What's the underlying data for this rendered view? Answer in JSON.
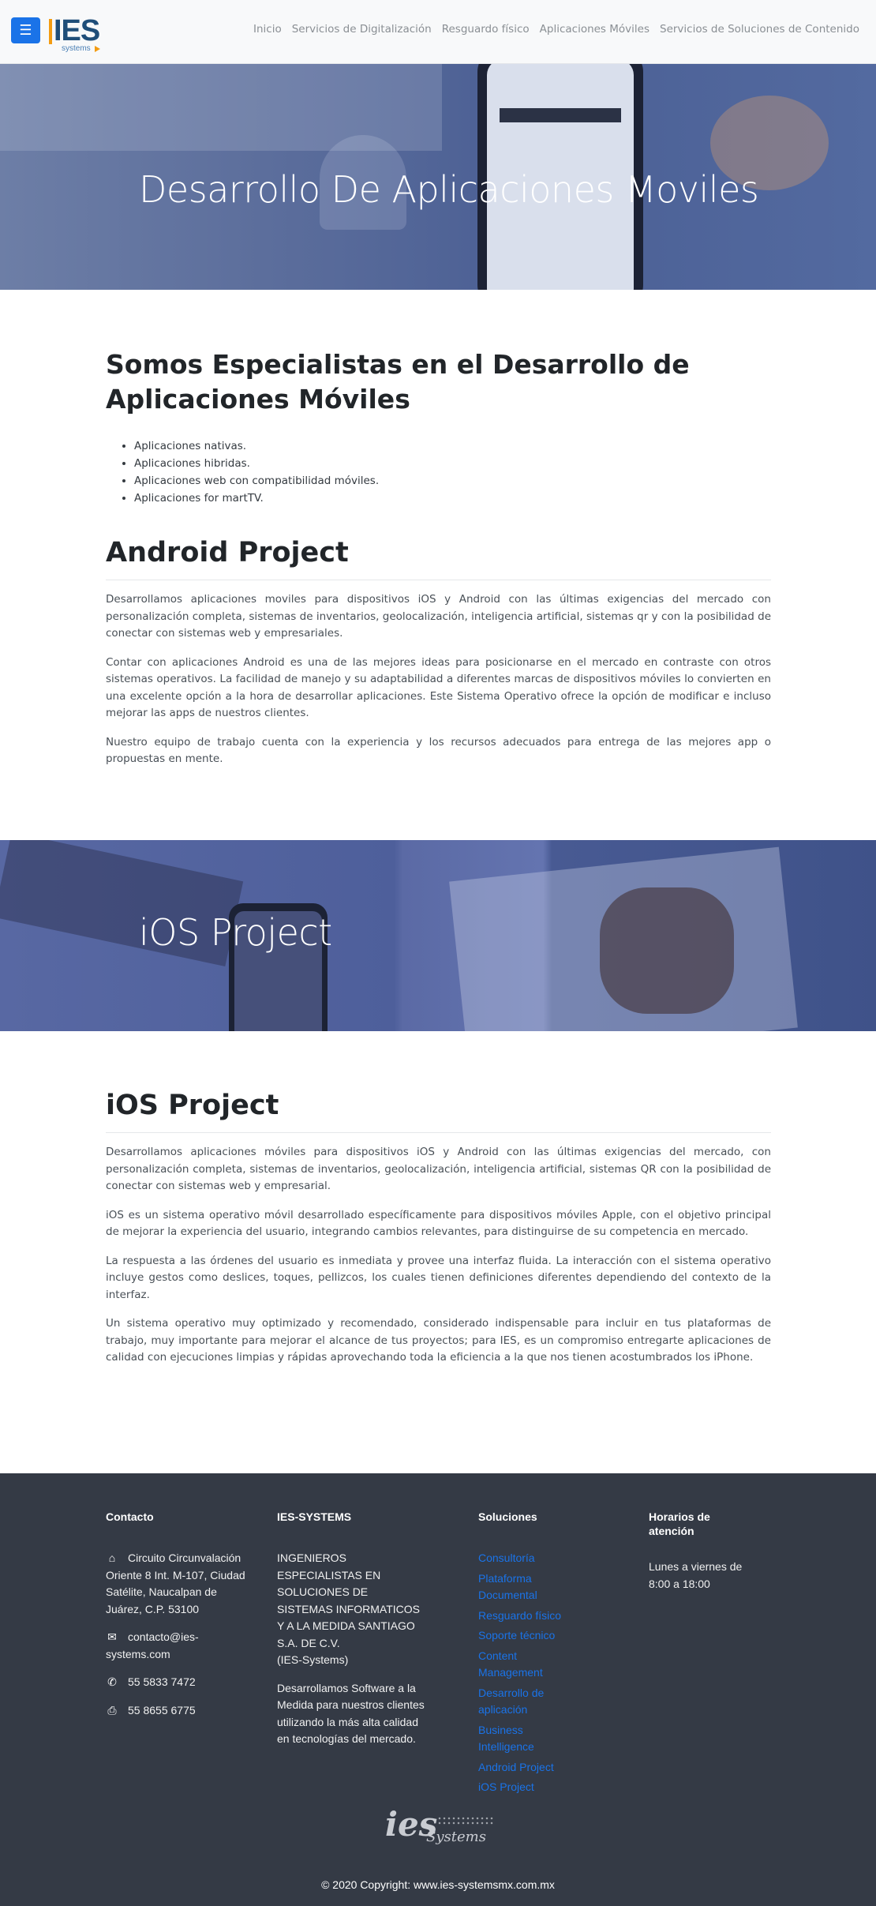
{
  "navbar": {
    "toggle_icon": "☰",
    "logo": {
      "text": "IES",
      "sub": "systems"
    },
    "links": [
      "Inicio",
      "Servicios de Digitalización",
      "Resguardo físico",
      "Aplicaciones Móviles",
      "Servicios de Soluciones de Contenido"
    ]
  },
  "hero": {
    "title": "Desarrollo De Aplicaciones Moviles"
  },
  "intro": {
    "heading": "Somos Especialistas en el Desarrollo de Aplicaciones Móviles",
    "features": [
      "Aplicaciones nativas.",
      "Aplicaciones hibridas.",
      "Aplicaciones web con compatibilidad móviles.",
      "Aplicaciones for martTV."
    ]
  },
  "android": {
    "heading": "Android Project",
    "paragraphs": [
      "Desarrollamos aplicaciones moviles para dispositivos iOS y Android con las últimas exigencias del mercado con personalización completa, sistemas de inventarios, geolocalización, inteligencia artificial, sistemas qr y con la posibilidad de conectar con sistemas web y empresariales.",
      "Contar con aplicaciones Android es una de las mejores ideas para posicionarse en el mercado en contraste con otros sistemas operativos. La facilidad de manejo y su adaptabilidad a diferentes marcas de dispositivos móviles lo convierten en una excelente opción a la hora de desarrollar aplicaciones. Este Sistema Operativo ofrece la opción de modificar e incluso mejorar las apps de nuestros clientes.",
      "Nuestro equipo de trabajo cuenta con la experiencia y los recursos adecuados para entrega de las mejores app o propuestas en mente."
    ]
  },
  "ios_banner": {
    "title": "iOS Project"
  },
  "ios": {
    "heading": "iOS Project",
    "paragraphs": [
      "Desarrollamos aplicaciones móviles para dispositivos iOS y Android con las últimas exigencias del mercado, con personalización completa, sistemas de inventarios, geolocalización, inteligencia artificial, sistemas QR con la posibilidad de conectar con sistemas web y empresarial.",
      "iOS es un sistema operativo móvil desarrollado específicamente para dispositivos móviles Apple, con el objetivo principal de mejorar la experiencia del usuario, integrando cambios relevantes, para distinguirse de su competencia en mercado.",
      "La respuesta a las órdenes del usuario es inmediata y provee una interfaz fluida. La interacción con el sistema operativo incluye gestos como deslices, toques, pellizcos, los cuales tienen definiciones diferentes dependiendo del contexto de la interfaz.",
      "Un sistema operativo muy optimizado y recomendado, considerado indispensable para incluir en tus plataformas de trabajo, muy importante para mejorar el alcance de tus proyectos; para IES, es un compromiso entregarte aplicaciones de calidad con ejecuciones limpias y rápidas aprovechando toda la eficiencia a la que nos tienen acostumbrados los iPhone."
    ]
  },
  "footer": {
    "contacto": {
      "heading": "Contacto",
      "address": "Circuito Circunvalación Oriente 8 Int. M-107, Ciudad Satélite, Naucalpan de Juárez, C.P. 53100",
      "email": "contacto@ies-systems.com",
      "phone": "55 5833 7472",
      "fax": "55 8655 6775"
    },
    "company": {
      "heading": "IES-SYSTEMS",
      "lines": [
        "INGENIEROS",
        "ESPECIALISTAS EN",
        "SOLUCIONES DE",
        "SISTEMAS INFORMATICOS",
        "Y A LA MEDIDA SANTIAGO",
        "S.A. DE C.V.",
        "(IES-Systems)"
      ],
      "about": "Desarrollamos Software a la Medida para nuestros clientes utilizando la más alta calidad en tecnologías del mercado."
    },
    "soluciones": {
      "heading": "Soluciones",
      "links": [
        "Consultoría",
        "Plataforma Documental",
        "Resguardo físico",
        "Soporte técnico",
        "Content Management",
        "Desarrollo de aplicación",
        "Business Intelligence",
        "Android Project",
        "iOS Project"
      ]
    },
    "horarios": {
      "heading": "Horarios de atención",
      "text": "Lunes a viernes de 8:00 a 18:00"
    },
    "logo": {
      "text": "ies",
      "sub": "Systems"
    },
    "copyright": "© 2020 Copyright: www.ies-systemsmx.com.mx"
  }
}
